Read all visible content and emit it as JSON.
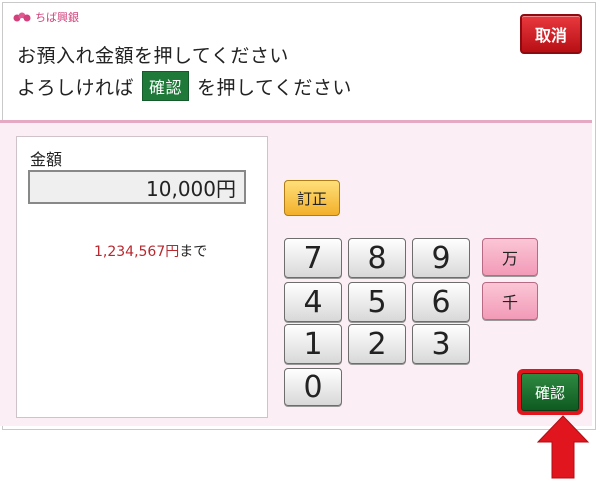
{
  "header": {
    "logo_text": "ちば興銀",
    "instruction_line1": "お預入れ金額を押してください",
    "instruction_line2_prefix": "よろしければ",
    "instruction_line2_chip": "確認",
    "instruction_line2_suffix": "を押してください",
    "cancel_label": "取消"
  },
  "amount": {
    "label": "金額",
    "value": "10,000円"
  },
  "limit": {
    "number": "1,234,567",
    "unit": "円",
    "suffix": "まで"
  },
  "keypad": {
    "correct_label": "訂正",
    "digits": [
      "7",
      "8",
      "9",
      "4",
      "5",
      "6",
      "1",
      "2",
      "3",
      "0"
    ],
    "man_label": "万",
    "sen_label": "千",
    "confirm_label": "確認"
  },
  "colors": {
    "accent_pink": "#e6a9c3",
    "cancel_red": "#c2141a",
    "confirm_green": "#1f7a3a",
    "arrow_red": "#e1151d"
  }
}
